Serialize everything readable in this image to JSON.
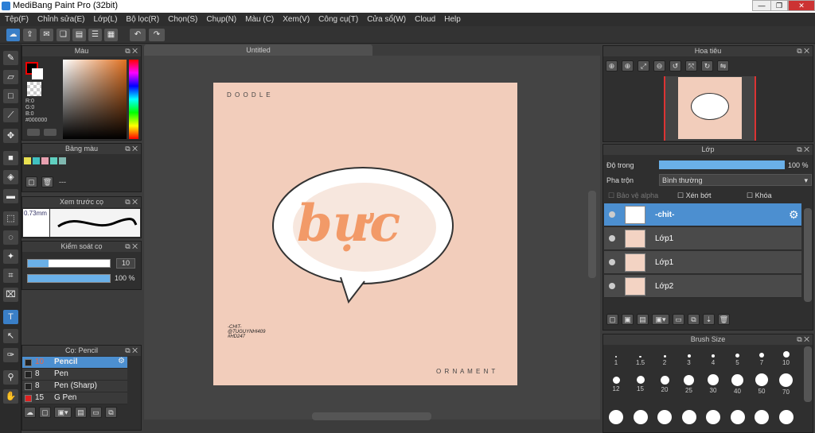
{
  "window": {
    "title": "MediBang Paint Pro (32bit)",
    "minimize": "—",
    "maximize": "❐",
    "close": "✕"
  },
  "menu": [
    "Tệp(F)",
    "Chỉnh sửa(E)",
    "Lớp(L)",
    "Bộ lọc(R)",
    "Chọn(S)",
    "Chụp(N)",
    "Màu (C)",
    "Xem(V)",
    "Công cụ(T)",
    "Cửa sổ(W)",
    "Cloud",
    "Help"
  ],
  "canvas": {
    "tab_title": "Untitled",
    "art_top": "D O O D L E",
    "art_word": "bực",
    "art_bottom": "O R N A M E N T",
    "art_credit1": "-CHIT-",
    "art_credit2": "@TUGUYNHI409",
    "art_credit3": "#HD247"
  },
  "color_panel": {
    "title": "Màu",
    "r": "R:0",
    "g": "G:0",
    "b": "B:0",
    "hex": "#000000",
    "fg": "#000000",
    "bg": "#ffffff"
  },
  "palette_panel": {
    "title": "Bảng màu",
    "swatches": [
      "#e8e050",
      "#40c0c0",
      "#e8a0b0",
      "#60d0c0",
      "#80b8b0"
    ],
    "dash": "---"
  },
  "brush_preview": {
    "title": "Xem trước cọ",
    "size": "0.73mm"
  },
  "brush_control": {
    "title": "Kiểm soát cọ",
    "size_value": "10",
    "opacity_value": "100 %",
    "size_fraction": 0.25,
    "opacity_fraction": 1.0
  },
  "brush_list": {
    "title": "Cọ: Pencil",
    "items": [
      {
        "size": "10",
        "name": "Pencil",
        "color": "#222222"
      },
      {
        "size": "8",
        "name": "Pen",
        "color": "#222222"
      },
      {
        "size": "8",
        "name": "Pen (Sharp)",
        "color": "#222222"
      },
      {
        "size": "15",
        "name": "G Pen",
        "color": "#e02020"
      }
    ]
  },
  "navigator": {
    "title": "Hoa tiêu"
  },
  "layers": {
    "title": "Lớp",
    "opacity_label": "Độ trong",
    "opacity_value": "100 %",
    "opacity_fraction": 1.0,
    "blend_label": "Pha trộn",
    "blend_value": "Bình thường",
    "protect_alpha": "Bảo vệ alpha",
    "clipping": "Xén bớt",
    "lock": "Khóa",
    "items": [
      {
        "name": "-chit-"
      },
      {
        "name": "Lớp1"
      },
      {
        "name": "Lớp1"
      },
      {
        "name": "Lớp2"
      }
    ]
  },
  "brush_size": {
    "title": "Brush Size",
    "labels": [
      "1",
      "1.5",
      "2",
      "3",
      "4",
      "5",
      "7",
      "10",
      "12",
      "15",
      "20",
      "25",
      "30",
      "40",
      "50",
      "70"
    ]
  }
}
